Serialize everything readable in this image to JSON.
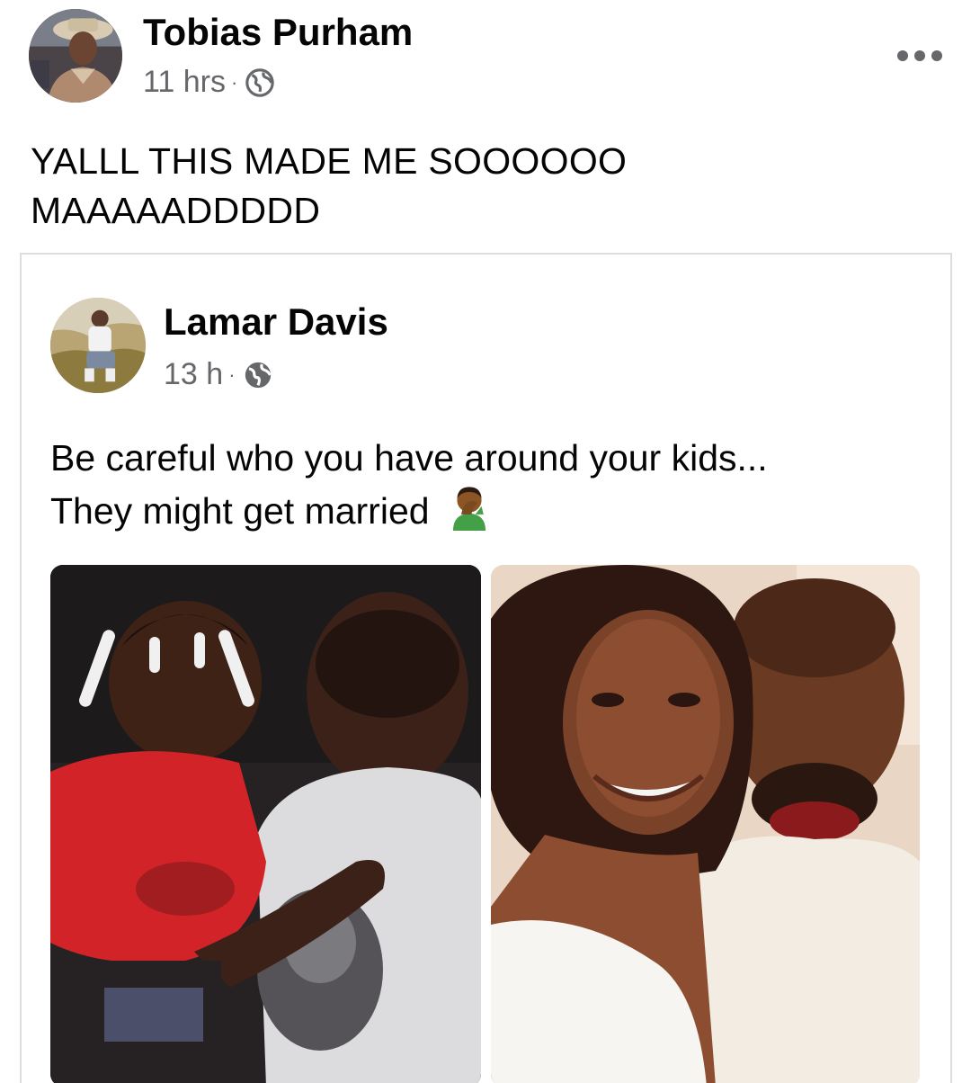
{
  "post": {
    "author": {
      "name": "Tobias Purham",
      "time": "11 hrs",
      "separator": "·",
      "privacy_icon": "globe-icon"
    },
    "text_lines": [
      "YALLL THIS MADE ME SOOOOOO",
      "MAAAAADDDDD"
    ],
    "more_icon": "more-options-icon"
  },
  "shared_post": {
    "author": {
      "name": "Lamar Davis",
      "time": "13 h",
      "separator": "·",
      "privacy_icon": "globe-icon"
    },
    "text_lines": [
      "Be careful who you have around your kids...",
      "They might get married"
    ],
    "emoji": "man-facepalming-emoji",
    "photos": [
      {
        "description_icon": "photo-man-with-toddler"
      },
      {
        "description_icon": "photo-bride-and-groom"
      }
    ]
  },
  "colors": {
    "text_primary": "#050505",
    "text_secondary": "#65676b",
    "border": "#dadde1"
  }
}
